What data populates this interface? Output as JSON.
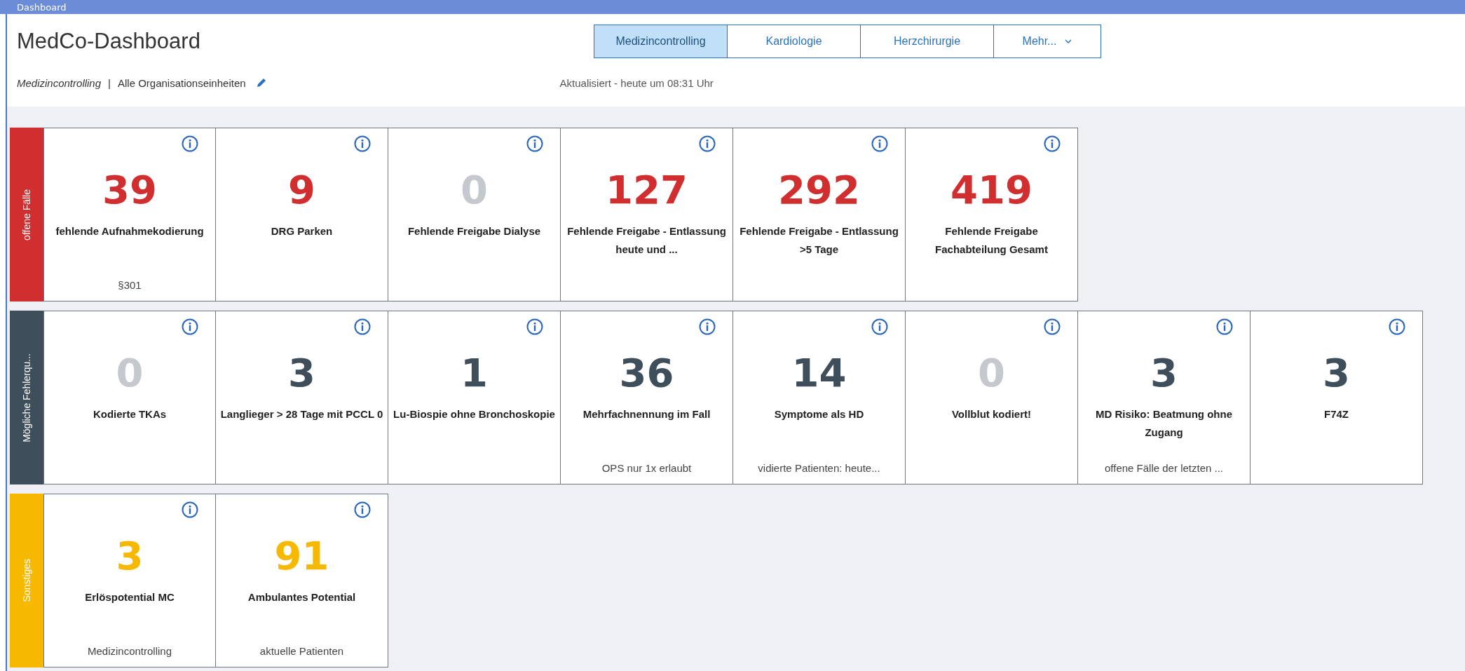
{
  "window": {
    "title": "Dashboard"
  },
  "header": {
    "title": "MedCo-Dashboard",
    "context": "Medizincontrolling",
    "separator": "|",
    "scope": "Alle Organisationseinheiten",
    "updated": "Aktualisiert - heute um 08:31 Uhr"
  },
  "tabs": [
    {
      "label": "Medizincontrolling",
      "selected": true
    },
    {
      "label": "Kardiologie",
      "selected": false
    },
    {
      "label": "Herzchirurgie",
      "selected": false
    },
    {
      "label": "Mehr...",
      "selected": false,
      "kind": "dropdown"
    }
  ],
  "groups": [
    {
      "label": "offene Fälle",
      "color": "#d12f2f",
      "tiles": [
        {
          "value": "39",
          "color": "#d12f2f",
          "label": "fehlende Aufnahmekodierung",
          "note": "§301"
        },
        {
          "value": "9",
          "color": "#d12f2f",
          "label": "DRG Parken"
        },
        {
          "value": "0",
          "color": "#c5c9cd",
          "label": "Fehlende Freigabe Dialyse"
        },
        {
          "value": "127",
          "color": "#d12f2f",
          "label": "Fehlende Freigabe - Entlassung heute und ..."
        },
        {
          "value": "292",
          "color": "#d12f2f",
          "label": "Fehlende Freigabe - Entlassung >5 Tage"
        },
        {
          "value": "419",
          "color": "#d12f2f",
          "label": "Fehlende Freigabe Fachabteilung Gesamt"
        }
      ]
    },
    {
      "label": "Mögliche Fehlerqu...",
      "color": "#3e4e5a",
      "tiles": [
        {
          "value": "0",
          "color": "#c5c9cd",
          "label": "Kodierte TKAs"
        },
        {
          "value": "3",
          "color": "#3e4e5a",
          "label": "Langlieger > 28 Tage mit PCCL 0"
        },
        {
          "value": "1",
          "color": "#3e4e5a",
          "label": "Lu-Biospie ohne Bronchoskopie"
        },
        {
          "value": "36",
          "color": "#3e4e5a",
          "label": "Mehrfachnennung im Fall",
          "note": "OPS nur 1x erlaubt"
        },
        {
          "value": "14",
          "color": "#3e4e5a",
          "label": "Symptome als HD",
          "note": "vidierte Patienten: heute..."
        },
        {
          "value": "0",
          "color": "#c5c9cd",
          "label": "Vollblut kodiert!"
        },
        {
          "value": "3",
          "color": "#3e4e5a",
          "label": "MD Risiko: Beatmung ohne Zugang",
          "note": "offene Fälle der letzten ..."
        },
        {
          "value": "3",
          "color": "#3e4e5a",
          "label": "F74Z"
        }
      ]
    },
    {
      "label": "Sonstiges",
      "color": "#f6b900",
      "tiles": [
        {
          "value": "3",
          "color": "#f6b900",
          "label": "Erlöspotential MC",
          "note": "Medizincontrolling"
        },
        {
          "value": "91",
          "color": "#f6b900",
          "label": "Ambulantes Potential",
          "note": "aktuelle Patienten"
        }
      ]
    }
  ]
}
